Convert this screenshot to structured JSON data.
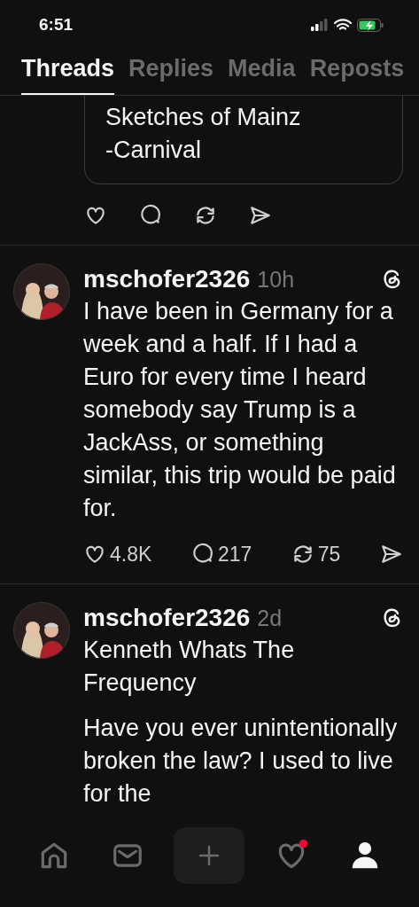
{
  "status_bar": {
    "time": "6:51"
  },
  "tabs": [
    {
      "label": "Threads",
      "selected": true
    },
    {
      "label": "Replies",
      "selected": false
    },
    {
      "label": "Media",
      "selected": false
    },
    {
      "label": "Reposts",
      "selected": false
    }
  ],
  "quote_tail": {
    "text": "Sketches of Mainz\n-Carnival"
  },
  "posts": [
    {
      "username": "mschofer2326",
      "time": "10h",
      "text": "I have been in Germany for a week and a half. If I had a Euro for every time I heard somebody say Trump is a JackAss, or something similar, this trip would be paid for.",
      "stats": {
        "likes": "4.8K",
        "replies": "217",
        "reposts": "75"
      }
    },
    {
      "username": "mschofer2326",
      "time": "2d",
      "title": "Kenneth Whats The Frequency",
      "text": "Have you ever unintentionally broken the law? I used to live for the"
    }
  ],
  "nav": [
    {
      "kind": "home",
      "selected": false,
      "badge": false
    },
    {
      "kind": "inbox",
      "selected": false,
      "badge": false
    },
    {
      "kind": "compose",
      "selected": false,
      "badge": false
    },
    {
      "kind": "activity",
      "selected": false,
      "badge": true
    },
    {
      "kind": "profile",
      "selected": true,
      "badge": false
    }
  ]
}
